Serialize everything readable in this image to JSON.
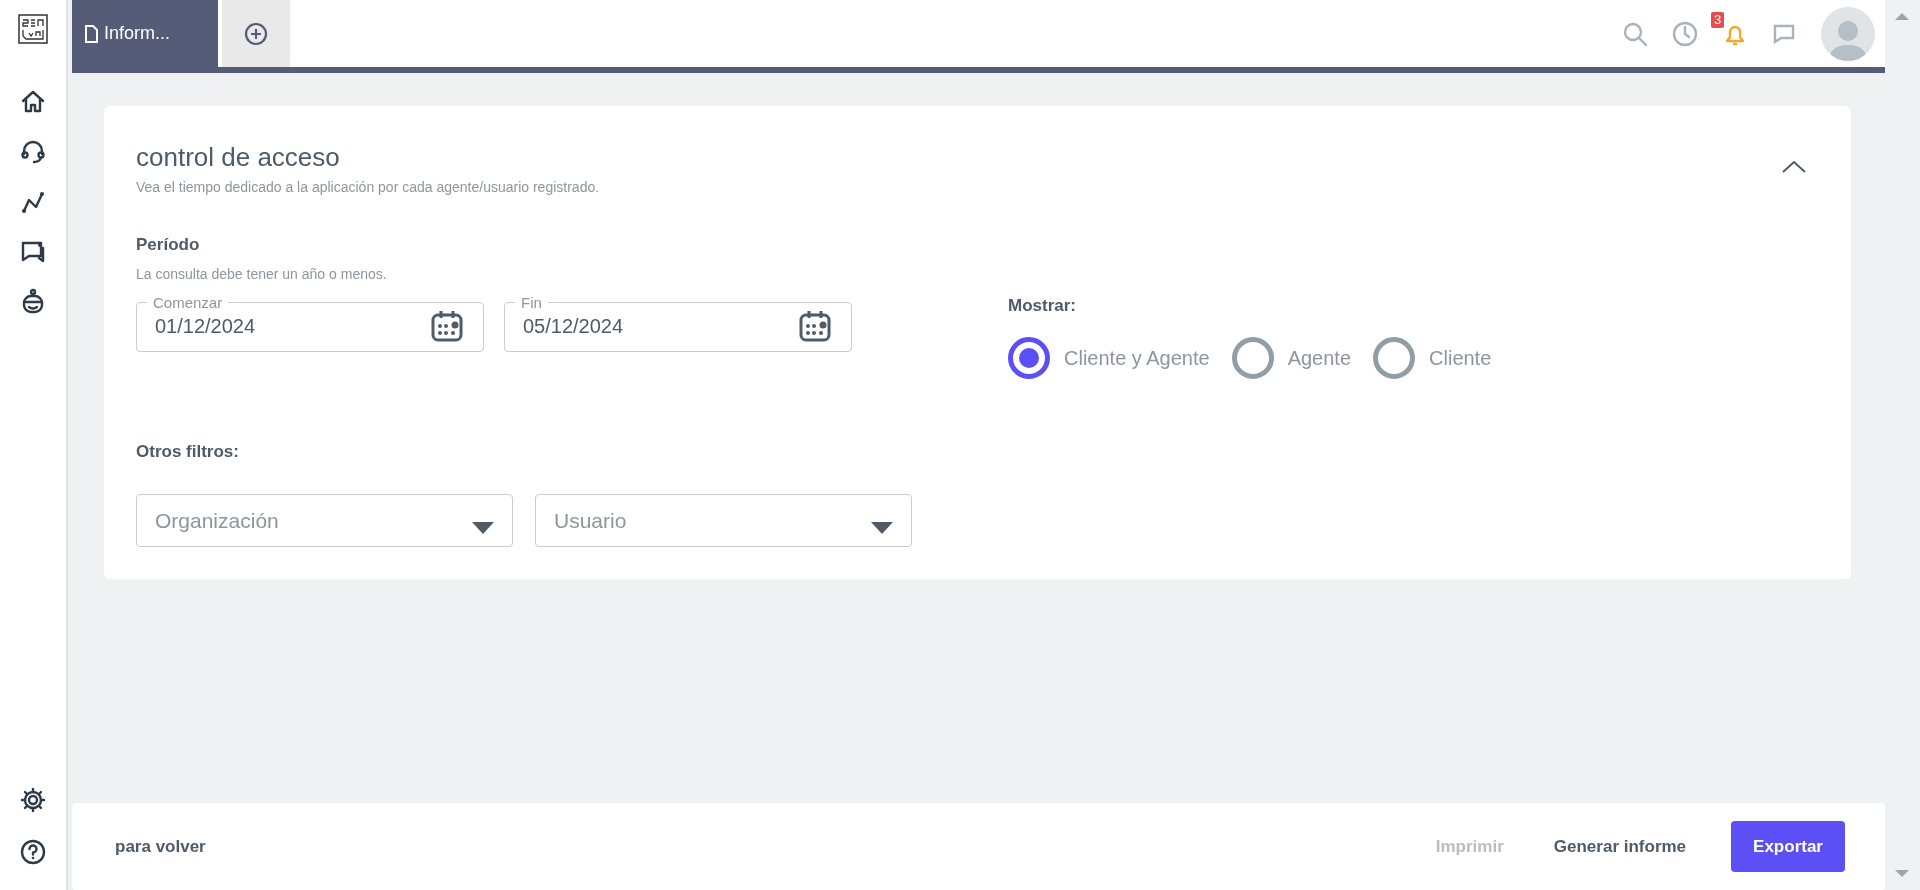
{
  "tabs": [
    {
      "label": "Inform...",
      "selected": true
    }
  ],
  "header": {
    "notification_count": "3"
  },
  "card": {
    "title": "control de acceso",
    "subtitle": "Vea el tiempo dedicado a la aplicación por cada agente/usuario registrado.",
    "period": {
      "label": "Período",
      "hint": "La consulta debe tener un año o menos.",
      "dates": [
        {
          "label": "Comenzar",
          "value": "01/12/2024"
        },
        {
          "label": "Fin",
          "value": "05/12/2024"
        }
      ]
    },
    "show": {
      "label": "Mostrar:",
      "options": [
        {
          "label": "Cliente y Agente",
          "selected": true
        },
        {
          "label": "Agente",
          "selected": false
        },
        {
          "label": "Cliente",
          "selected": false
        }
      ]
    },
    "filters": {
      "label": "Otros filtros:",
      "dropdowns": [
        {
          "placeholder": "Organización"
        },
        {
          "placeholder": "Usuario"
        }
      ]
    }
  },
  "footer": {
    "back": "para volver",
    "buttons": [
      {
        "label": "Imprimir",
        "kind": "text",
        "disabled": true
      },
      {
        "label": "Generar informe",
        "kind": "text",
        "disabled": false
      },
      {
        "label": "Exportar",
        "kind": "primary",
        "disabled": false
      }
    ]
  }
}
